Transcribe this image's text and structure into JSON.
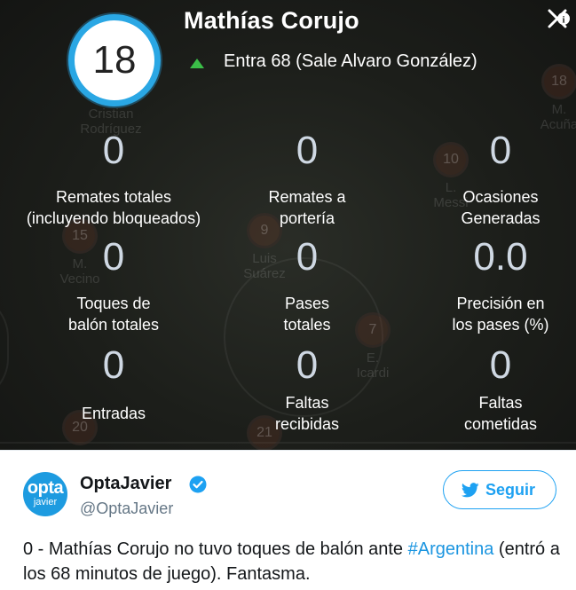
{
  "card": {
    "player_number": "18",
    "player_name": "Mathías Corujo",
    "substitution_text": "Entra 68 (Sale Alvaro González)",
    "stats": [
      {
        "value": "0",
        "label_line1": "Remates totales",
        "label_line2": "(incluyendo bloqueados)"
      },
      {
        "value": "0",
        "label_line1": "Remates a",
        "label_line2": "portería"
      },
      {
        "value": "0",
        "label_line1": "Ocasiones",
        "label_line2": "Generadas"
      },
      {
        "value": "0",
        "label_line1": "Toques de",
        "label_line2": "balón totales"
      },
      {
        "value": "0",
        "label_line1": "Pases",
        "label_line2": "totales"
      },
      {
        "value": "0.0",
        "label_line1": "Precisión en",
        "label_line2": "los pases (%)"
      },
      {
        "value": "0",
        "label_line1": "Entradas",
        "label_line2": ""
      },
      {
        "value": "0",
        "label_line1": "Faltas",
        "label_line2": "recibidas"
      },
      {
        "value": "0",
        "label_line1": "Faltas",
        "label_line2": "cometidas"
      }
    ],
    "background_players": [
      {
        "number": "",
        "name_line1": "Cristian",
        "name_line2": "Rodríguez"
      },
      {
        "number": "18",
        "name_line1": "M.",
        "name_line2": "Acuña"
      },
      {
        "number": "10",
        "name_line1": "L.",
        "name_line2": "Messi"
      },
      {
        "number": "15",
        "name_line1": "M.",
        "name_line2": "Vecino"
      },
      {
        "number": "9",
        "name_line1": "Luis",
        "name_line2": "Suárez"
      },
      {
        "number": "7",
        "name_line1": "E.",
        "name_line2": "Icardi"
      },
      {
        "number": "20",
        "name_line1": "",
        "name_line2": ""
      },
      {
        "number": "21",
        "name_line1": "",
        "name_line2": ""
      }
    ],
    "accent_color": "#2aa7e4",
    "arrow_color": "#3bbf48"
  },
  "tweet": {
    "avatar_line1": "opta",
    "avatar_line2": "javier",
    "account_name": "OptaJavier",
    "handle": "@OptaJavier",
    "follow_label": "Seguir",
    "text_before": "0 - Mathías Corujo no tuvo toques de balón ante ",
    "hashtag": "#Argentina",
    "text_after": " (entró a los 68 minutos de juego). Fantasma.",
    "brand_color": "#1da1f2"
  }
}
